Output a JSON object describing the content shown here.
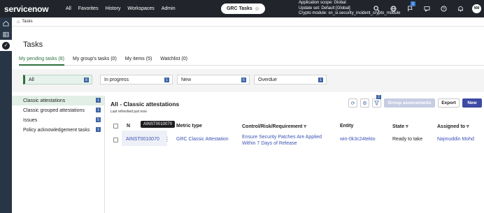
{
  "app": {
    "logo": "servicenow",
    "nav": [
      "All",
      "Favorites",
      "History",
      "Workspaces",
      "Admin"
    ],
    "workspace_pill": "GRC Tasks",
    "scope_lines": [
      "Application scope: Global",
      "Update set: Default [Global]",
      "Crypto module: sn_si.security_incident_crypto_module"
    ],
    "notification_count": "1",
    "avatar_initials": "NM"
  },
  "breadcrumb": "Tasks",
  "page_title": "Tasks",
  "tabs": [
    {
      "label": "My pending tasks (8)"
    },
    {
      "label": "My group's tasks (0)"
    },
    {
      "label": "My items (5)"
    },
    {
      "label": "Watchlist (0)"
    }
  ],
  "filters": [
    {
      "label": "All",
      "count": "8"
    },
    {
      "label": "In progress",
      "count": "1"
    },
    {
      "label": "New",
      "count": "6"
    },
    {
      "label": "Overdue",
      "count": "1"
    }
  ],
  "sidebar": [
    {
      "label": "Classic attestations",
      "count": "1"
    },
    {
      "label": "Classic grouped attestations",
      "count": "1"
    },
    {
      "label": "Issues",
      "count": "5"
    },
    {
      "label": "Policy acknowledgement tasks",
      "count": "1"
    }
  ],
  "list": {
    "title": "All - Classic attestations",
    "subtitle": "Last refreshed just now",
    "filter_badge": "2",
    "buttons": {
      "assess": "Group assessments",
      "export": "Export",
      "new": "New"
    },
    "columns": {
      "number": "N",
      "metric": "Metric type",
      "control": "Control/Risk/Requirement",
      "entity": "Entity",
      "state": "State",
      "assigned": "Assigned to"
    },
    "tooltip": "AINST0010070",
    "row": {
      "number": "AINST0010070",
      "metric": "GRC Classic Attestation",
      "control_line1": "Ensure Security Patches Are Applied",
      "control_line2": "Within 7 Days of Release",
      "entity": "win-0k3c24tekto",
      "state": "Ready to take",
      "assigned": "Najmuddin Mohd"
    }
  },
  "colors": {
    "topbar": "#21252b",
    "rail": "#283544",
    "accent_green": "#2f6f3e",
    "primary": "#3c4aa3",
    "link": "#3c52b5"
  }
}
